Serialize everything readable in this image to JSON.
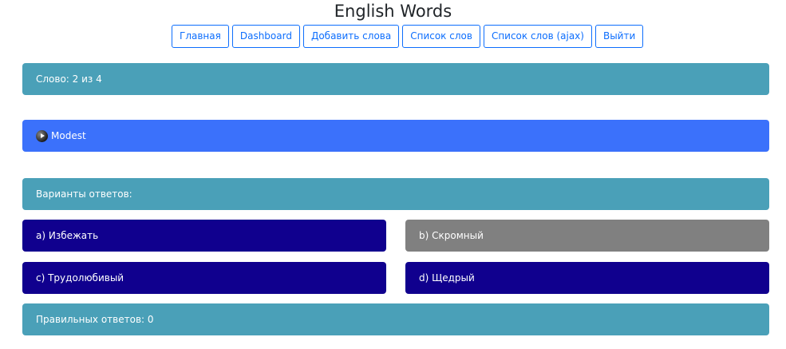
{
  "page_title": "English Words",
  "nav": {
    "home": "Главная",
    "dashboard": "Dashboard",
    "add_words": "Добавить слова",
    "word_list": "Список слов",
    "word_list_ajax": "Список слов (ajax)",
    "logout": "Выйти"
  },
  "quiz": {
    "counter": "Слово: 2 из 4",
    "word": "Modest",
    "variants_label": "Варианты ответов:",
    "answers": [
      {
        "text": "a) Избежать"
      },
      {
        "text": "b) Скромный"
      },
      {
        "text": "c) Трудолюбивый"
      },
      {
        "text": "d) Щедрый"
      }
    ],
    "score": "Правильных ответов: 0"
  },
  "colors": {
    "info": "#4aa0b8",
    "primary": "#3b71fb",
    "answer": "#10008e",
    "answer_selected": "#808080",
    "nav_border": "#0d6efd"
  },
  "icons": {
    "audio": "play-audio-icon"
  }
}
